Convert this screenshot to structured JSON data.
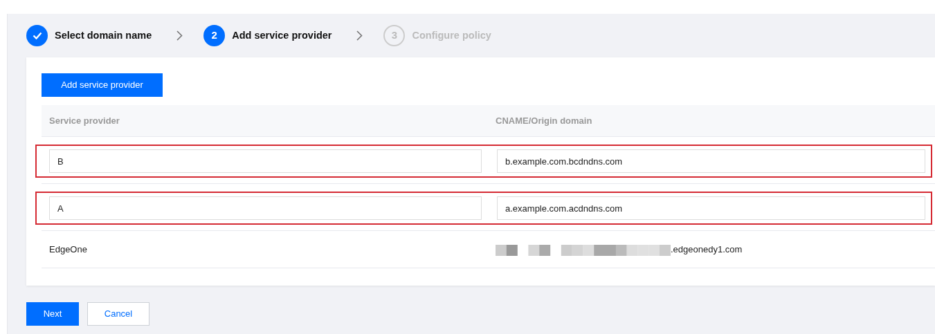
{
  "steps": [
    {
      "kind": "completed",
      "label": "Select domain name"
    },
    {
      "kind": "active",
      "number": "2",
      "label": "Add service provider"
    },
    {
      "kind": "upcoming",
      "number": "3",
      "label": "Configure policy"
    }
  ],
  "add_button": "Add service provider",
  "table": {
    "columns": [
      "Service provider",
      "CNAME/Origin domain"
    ],
    "rows": [
      {
        "kind": "input",
        "highlighted": true,
        "provider": "B",
        "domain": "b.example.com.bcdndns.com"
      },
      {
        "kind": "input",
        "highlighted": true,
        "provider": "A",
        "domain": "a.example.com.acdndns.com"
      },
      {
        "kind": "text",
        "highlighted": false,
        "provider": "EdgeOne",
        "domain": ".edgeonedy1.com",
        "masked": true
      }
    ]
  },
  "footer_buttons": [
    {
      "label": "Next",
      "kind": "primary"
    },
    {
      "label": "Cancel",
      "kind": "secondary"
    }
  ]
}
